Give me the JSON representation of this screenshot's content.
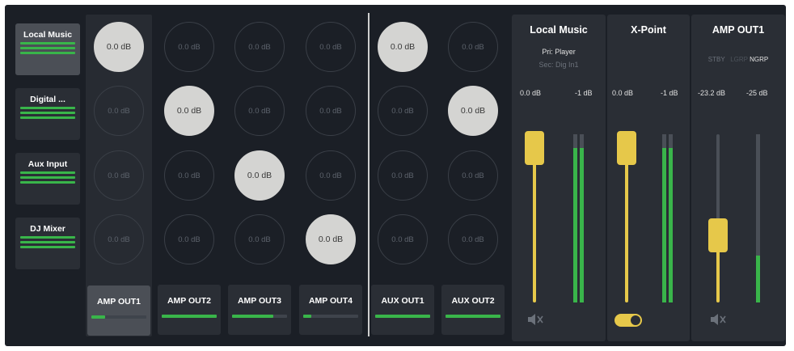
{
  "inputs": [
    {
      "label": "Local Music",
      "active": true
    },
    {
      "label": "Digital ...",
      "active": false
    },
    {
      "label": "Aux Input",
      "active": false
    },
    {
      "label": "DJ Mixer",
      "active": false
    }
  ],
  "outputs": [
    {
      "label": "AMP OUT1",
      "active": true,
      "level": 0.25
    },
    {
      "label": "AMP OUT2",
      "active": false,
      "level": 1.0
    },
    {
      "label": "AMP OUT3",
      "active": false,
      "level": 0.75
    },
    {
      "label": "AMP OUT4",
      "active": false,
      "level": 0.15
    },
    {
      "label": "AUX OUT1",
      "active": false,
      "level": 1.0
    },
    {
      "label": "AUX OUT2",
      "active": false,
      "level": 1.0
    }
  ],
  "crosspoints": [
    [
      "0.0 dB",
      "0.0 dB",
      "0.0 dB",
      "0.0 dB",
      "0.0 dB",
      "0.0 dB"
    ],
    [
      "0.0 dB",
      "0.0 dB",
      "0.0 dB",
      "0.0 dB",
      "0.0 dB",
      "0.0 dB"
    ],
    [
      "0.0 dB",
      "0.0 dB",
      "0.0 dB",
      "0.0 dB",
      "0.0 dB",
      "0.0 dB"
    ],
    [
      "0.0 dB",
      "0.0 dB",
      "0.0 dB",
      "0.0 dB",
      "0.0 dB",
      "0.0 dB"
    ]
  ],
  "crosspoint_on": [
    [
      true,
      false,
      false,
      false,
      true,
      false
    ],
    [
      false,
      true,
      false,
      false,
      false,
      true
    ],
    [
      false,
      false,
      true,
      false,
      false,
      false
    ],
    [
      false,
      false,
      false,
      true,
      false,
      false
    ]
  ],
  "strip_local": {
    "title": "Local Music",
    "pri": "Pri: Player",
    "sec": "Sec: Dig In1",
    "fader_value": "0.0 dB",
    "meter_value": "-1 dB",
    "fader_level": 0.92,
    "meter_level": 0.92,
    "mute_icon": "speaker-muted-icon"
  },
  "strip_xpoint": {
    "title": "X-Point",
    "fader_value": "0.0 dB",
    "meter_value": "-1 dB",
    "fader_level": 0.92,
    "meter_level": 0.92,
    "toggle_on": true
  },
  "strip_amp": {
    "title": "AMP OUT1",
    "opt_stby": "STBY",
    "opt_lgrp": "LGRP",
    "opt_ngrp": "NGRP",
    "fader_value": "-23.2 dB",
    "meter_value": "-25 dB",
    "fader_level": 0.4,
    "meter_level": 0.28,
    "mute_icon": "speaker-muted-icon"
  },
  "colors": {
    "accent": "#e6c84a",
    "meter": "#39b54a",
    "background": "#1b1f26"
  }
}
